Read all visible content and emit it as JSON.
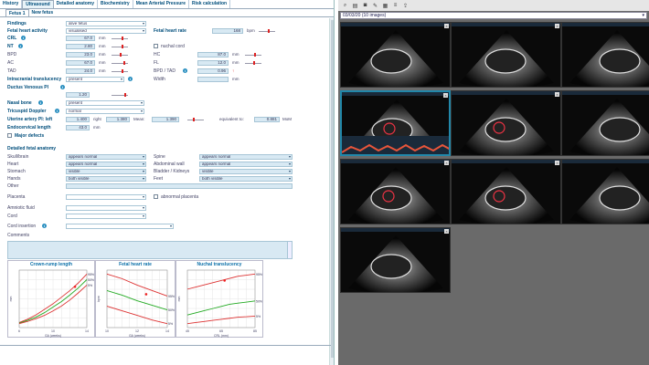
{
  "tabs": [
    "History",
    "Ultrasound",
    "Detailed anatomy",
    "Biochemistry",
    "Mean Arterial Pressure",
    "Risk calculation"
  ],
  "fetus_tabs": [
    "Fetus 1",
    "New fetus"
  ],
  "fields": {
    "findings": {
      "label": "Findings",
      "value": "alive fetus"
    },
    "fetal_heart_activity": {
      "label": "Fetal heart activity",
      "value": "visualised"
    },
    "fetal_heart_rate": {
      "label": "Fetal heart rate",
      "value": "168",
      "unit": "bpm"
    },
    "crl": {
      "label": "CRL",
      "value": "67.0",
      "unit": "mm"
    },
    "nuchal_cord": {
      "label": "nuchal cord"
    },
    "nt": {
      "label": "NT",
      "value": "2.80",
      "unit": "mm"
    },
    "bpd": {
      "label": "BPD",
      "value": "23.0",
      "unit": "mm"
    },
    "hc": {
      "label": "HC",
      "value": "87.0",
      "unit": "mm"
    },
    "ac": {
      "label": "AC",
      "value": "67.0",
      "unit": "mm"
    },
    "fl": {
      "label": "FL",
      "value": "12.0",
      "unit": "mm"
    },
    "tad": {
      "label": "TAD",
      "value": "24.0",
      "unit": "mm"
    },
    "bpd_tad": {
      "label": "BPD / TAD",
      "value": "0.96",
      "flag": "↑"
    },
    "intracranial": {
      "label": "Intracranial translucency",
      "value": "present"
    },
    "width": {
      "label": "Width",
      "unit": "mm"
    },
    "ductus": {
      "label": "Ductus Venosus PI",
      "value": "1.20"
    },
    "nasal_bone": {
      "label": "Nasal bone",
      "value": "present"
    },
    "tricuspid": {
      "label": "Tricuspid Doppler",
      "value": "normal"
    },
    "uterine": {
      "label": "Uterine artery PI: left",
      "left": "1.400",
      "right_label": "right",
      "right": "1.380",
      "mean_label": "Mean:",
      "mean": "1.390",
      "equiv_label": "equivalent to:",
      "equiv": "0.881",
      "equiv_unit": "MoM"
    },
    "endocervical": {
      "label": "Endocervical length",
      "value": "43.0",
      "unit": "mm"
    },
    "major_defects": {
      "label": "Major defects"
    }
  },
  "anatomy_title": "Detailed fetal anatomy",
  "anatomy_left": [
    {
      "label": "Skull/brain",
      "value": "appears normal"
    },
    {
      "label": "Heart",
      "value": "appears normal"
    },
    {
      "label": "Stomach",
      "value": "visible"
    },
    {
      "label": "Hands",
      "value": "both visible"
    },
    {
      "label": "Other",
      "value": ""
    }
  ],
  "anatomy_right": [
    {
      "label": "Spine",
      "value": "appears normal"
    },
    {
      "label": "Abdominal wall",
      "value": "appears normal"
    },
    {
      "label": "Bladder / Kidneys",
      "value": "visible"
    },
    {
      "label": "Feet",
      "value": "both visible"
    }
  ],
  "placenta": {
    "label": "Placenta",
    "value": "",
    "abnormal_label": "abnormal placenta"
  },
  "amniotic": {
    "label": "Amniotic fluid",
    "value": ""
  },
  "cord": {
    "label": "Cord",
    "value": ""
  },
  "cord_insertion": {
    "label": "Cord insertion",
    "value": ""
  },
  "comments_label": "Comments",
  "charts": [
    {
      "title": "Crown-rump length",
      "xlabel": "GA (weeks)",
      "ylabel": "mm",
      "type": "line"
    },
    {
      "title": "Fetal heart rate",
      "xlabel": "GA (weeks)",
      "ylabel": "bpm",
      "type": "line"
    },
    {
      "title": "Nuchal translucency",
      "xlabel": "CRL (mm)",
      "ylabel": "mm",
      "type": "line"
    }
  ],
  "chart_data": [
    {
      "type": "line",
      "title": "Crown-rump length",
      "xlabel": "GA (weeks)",
      "ylabel": "mm",
      "x": [
        6,
        7,
        8,
        9,
        10,
        11,
        12,
        13,
        14
      ],
      "series": [
        {
          "values": [
            2,
            8,
            16,
            26,
            36,
            48,
            60,
            74,
            90
          ],
          "color": "#d33"
        },
        {
          "values": [
            1,
            6,
            12,
            20,
            30,
            40,
            52,
            65,
            80
          ],
          "color": "#2a2"
        },
        {
          "values": [
            0,
            4,
            9,
            15,
            23,
            32,
            43,
            56,
            70
          ],
          "color": "#d33"
        }
      ],
      "point": {
        "x": 12.6,
        "y": 67
      },
      "series_labels": [
        "95%",
        "50%",
        "5%"
      ]
    },
    {
      "type": "line",
      "title": "Fetal heart rate",
      "xlabel": "GA (weeks)",
      "ylabel": "bpm",
      "x": [
        10,
        11,
        12,
        13,
        14
      ],
      "series": [
        {
          "values": [
            190,
            185,
            178,
            172,
            166
          ],
          "color": "#d33"
        },
        {
          "values": [
            172,
            167,
            161,
            156,
            151
          ],
          "color": "#2a2"
        },
        {
          "values": [
            155,
            150,
            145,
            140,
            136
          ],
          "color": "#d33"
        }
      ],
      "point": {
        "x": 12.6,
        "y": 168
      },
      "series_labels": [
        "95%",
        "50%",
        "5%"
      ]
    },
    {
      "type": "line",
      "title": "Nuchal translucency",
      "xlabel": "CRL (mm)",
      "ylabel": "mm",
      "x": [
        45,
        50,
        55,
        60,
        65,
        70,
        75,
        80,
        85
      ],
      "series": [
        {
          "values": [
            2.4,
            2.5,
            2.6,
            2.7,
            2.8,
            2.9,
            3.0,
            3.05,
            3.1
          ],
          "color": "#d33"
        },
        {
          "values": [
            1.2,
            1.3,
            1.4,
            1.5,
            1.6,
            1.7,
            1.75,
            1.8,
            1.85
          ],
          "color": "#2a2"
        },
        {
          "values": [
            0.8,
            0.85,
            0.9,
            0.95,
            1.0,
            1.05,
            1.1,
            1.12,
            1.15
          ],
          "color": "#d33"
        }
      ],
      "point": {
        "x": 67,
        "y": 2.8
      },
      "series_labels": [
        "95%",
        "50%",
        "5%"
      ]
    }
  ],
  "viewer": {
    "selector": "03/03/20  (10 images)"
  },
  "colors": {
    "accent": "#0a6fa8",
    "field": "#d8e9f3"
  }
}
